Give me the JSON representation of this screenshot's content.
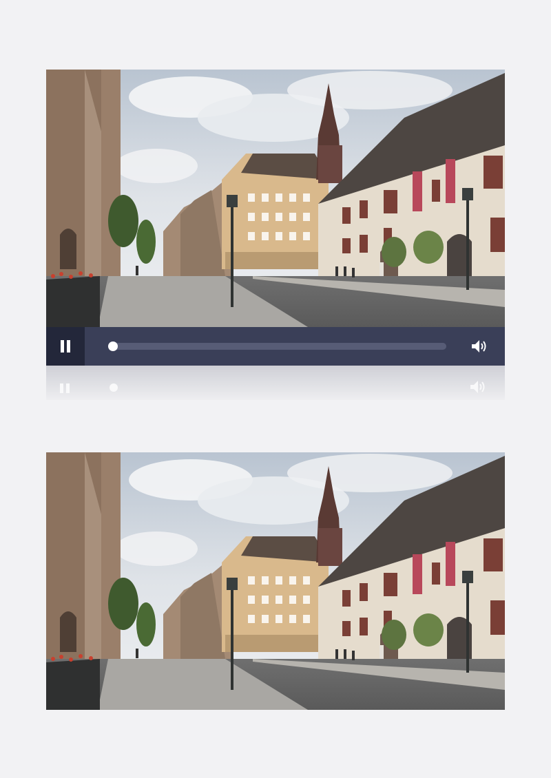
{
  "player": {
    "state": "playing",
    "play_pause_icon": "pause-icon",
    "progress_fraction": 0.01,
    "volume_icon": "volume-icon",
    "colors": {
      "control_bar": "#3a3f58",
      "play_button_bg": "#23273a",
      "track": "#575c76",
      "thumb": "#ffffff"
    }
  },
  "frames": [
    {
      "id": "video-frame-top",
      "subject": "street-scene"
    },
    {
      "id": "video-frame-bottom",
      "subject": "street-scene"
    }
  ]
}
